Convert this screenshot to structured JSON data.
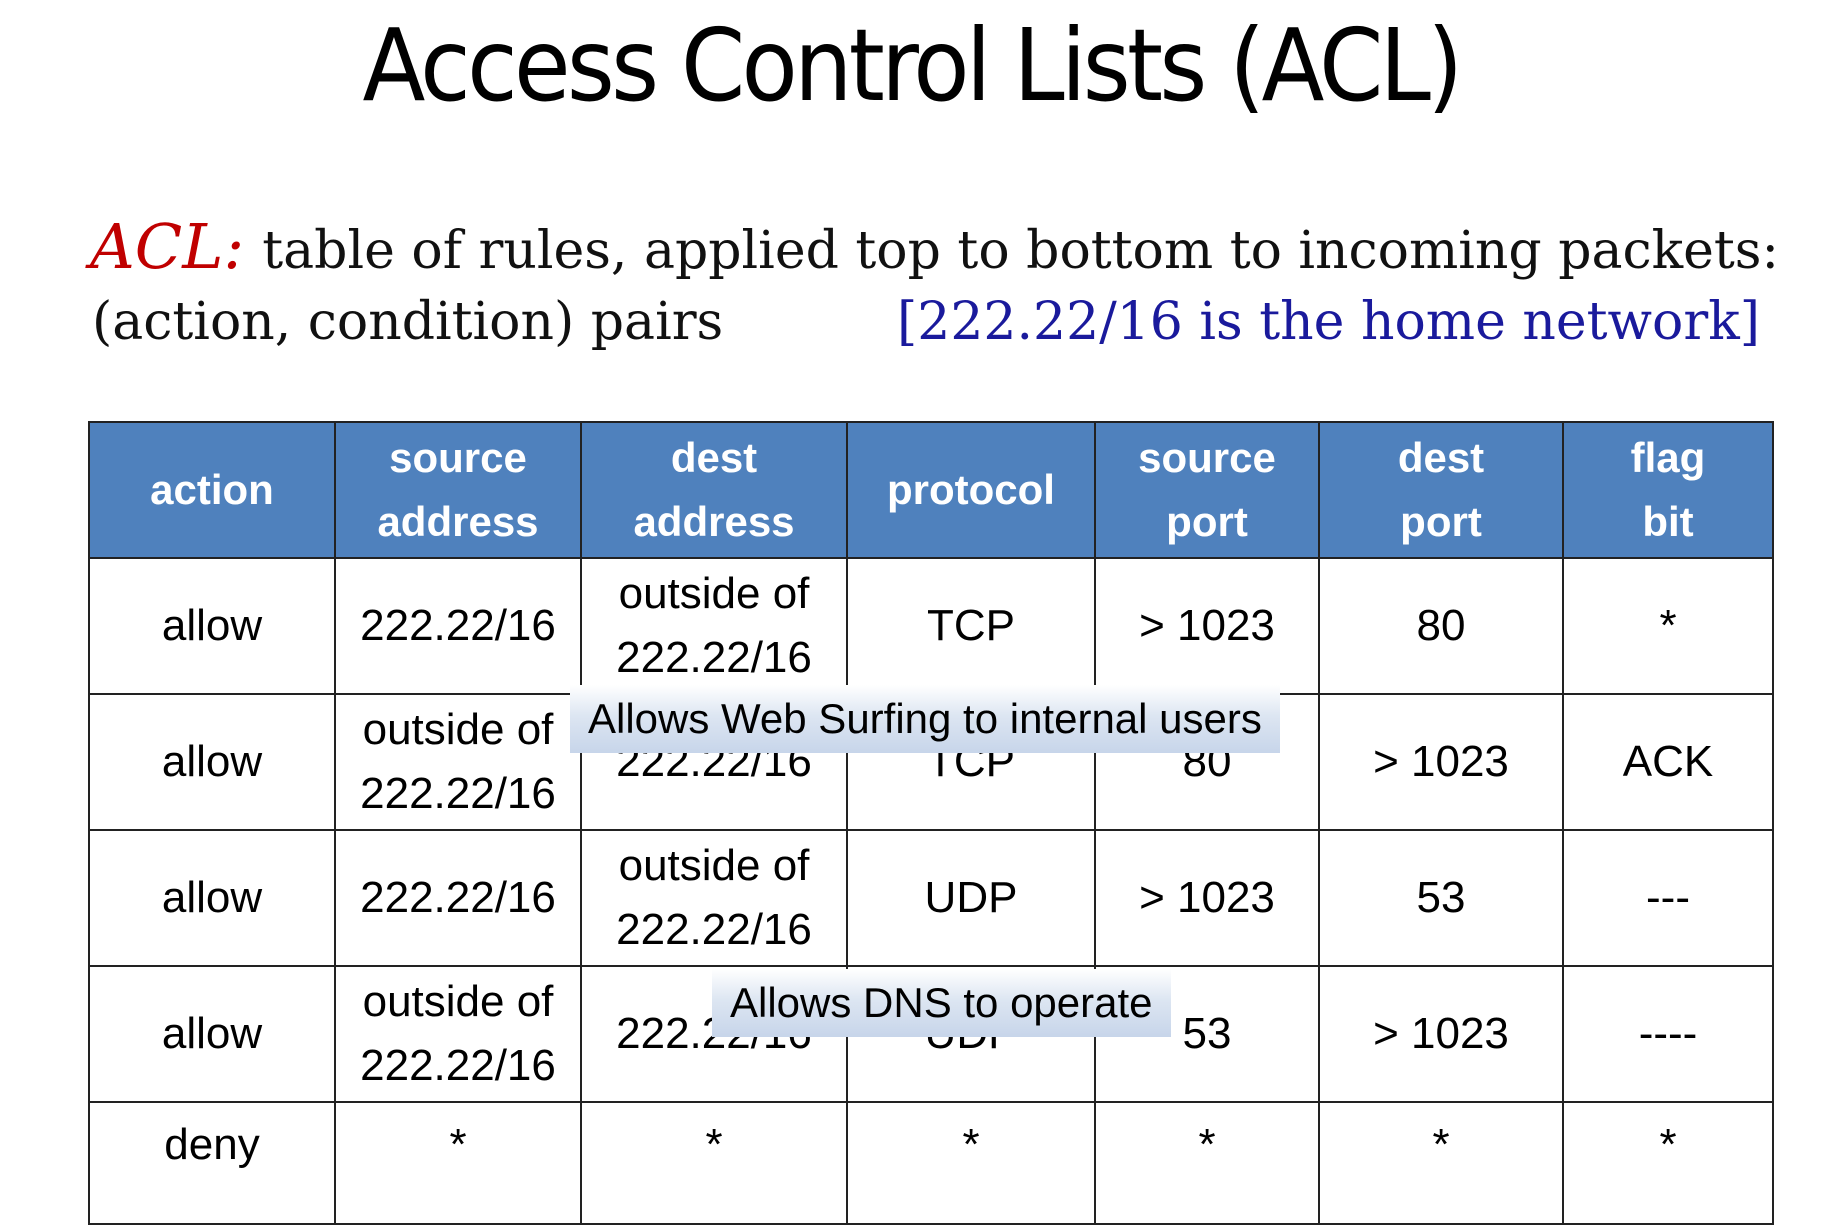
{
  "title": "Access Control Lists (ACL)",
  "description": {
    "term": "ACL:",
    "line1": "table of rules, applied top to bottom to incoming packets:",
    "line2": "(action, condition) pairs",
    "note": "[222.22/16 is the home network]"
  },
  "table": {
    "headers": [
      [
        "action"
      ],
      [
        "source",
        "address"
      ],
      [
        "dest",
        "address"
      ],
      [
        "protocol"
      ],
      [
        "source",
        "port"
      ],
      [
        "dest",
        "port"
      ],
      [
        "flag",
        "bit"
      ]
    ],
    "rows": [
      [
        [
          "allow"
        ],
        [
          "222.22/16"
        ],
        [
          "outside of",
          "222.22/16"
        ],
        [
          "TCP"
        ],
        [
          "> 1023"
        ],
        [
          "80"
        ],
        [
          "*"
        ]
      ],
      [
        [
          "allow"
        ],
        [
          "outside of",
          "222.22/16"
        ],
        [
          "222.22/16"
        ],
        [
          "TCP"
        ],
        [
          "80"
        ],
        [
          "> 1023"
        ],
        [
          "ACK"
        ]
      ],
      [
        [
          "allow"
        ],
        [
          "222.22/16"
        ],
        [
          "outside of",
          "222.22/16"
        ],
        [
          "UDP"
        ],
        [
          "> 1023"
        ],
        [
          "53"
        ],
        [
          "---"
        ]
      ],
      [
        [
          "allow"
        ],
        [
          "outside of",
          "222.22/16"
        ],
        [
          "222.22/16"
        ],
        [
          "UDP"
        ],
        [
          "53"
        ],
        [
          "> 1023"
        ],
        [
          "----"
        ]
      ],
      [
        [
          "deny"
        ],
        [
          "*"
        ],
        [
          "*"
        ],
        [
          "*"
        ],
        [
          "*"
        ],
        [
          "*"
        ],
        [
          "*"
        ]
      ]
    ]
  },
  "callouts": {
    "web": "Allows Web Surfing to internal users",
    "dns": "Allows DNS to operate"
  },
  "colors": {
    "header_bg": "#4f81bd",
    "acl_term": "#c00000",
    "note": "#1a1a9c"
  }
}
